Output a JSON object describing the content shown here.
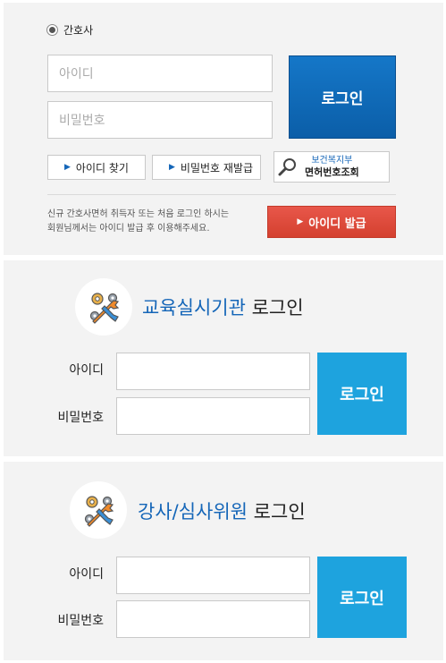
{
  "nurse": {
    "radio_label": "간호사",
    "id_placeholder": "아이디",
    "pw_placeholder": "비밀번호",
    "login_label": "로그인",
    "find_id_label": "아이디 찾기",
    "reissue_pw_label": "비밀번호 재발급",
    "license_lookup_line1": "보건복지부",
    "license_lookup_line2": "면허번호조회",
    "notice_line1": "신규 간호사면허 취득자 또는 처음 로그인 하시는",
    "notice_line2": "회원님께서는 아이디 발급 후 이용해주세요.",
    "issue_id_label": "아이디 발급"
  },
  "edu": {
    "title_highlight": "교육실시기관",
    "title_rest": " 로그인",
    "id_label": "아이디",
    "pw_label": "비밀번호",
    "login_label": "로그인"
  },
  "lecturer": {
    "title_highlight": "강사/심사위원",
    "title_rest": " 로그인",
    "id_label": "아이디",
    "pw_label": "비밀번호",
    "login_label": "로그인"
  },
  "colors": {
    "primary_blue": "#0b5ea8",
    "accent_cyan": "#1ea3de",
    "issue_red": "#d4402f",
    "panel_bg": "#f3f3f3"
  },
  "icons": {
    "radio": "radio-selected-icon",
    "arrow": "triangle-right-icon",
    "lookup": "magnifier-icon",
    "org": "wrench-gears-icon"
  }
}
